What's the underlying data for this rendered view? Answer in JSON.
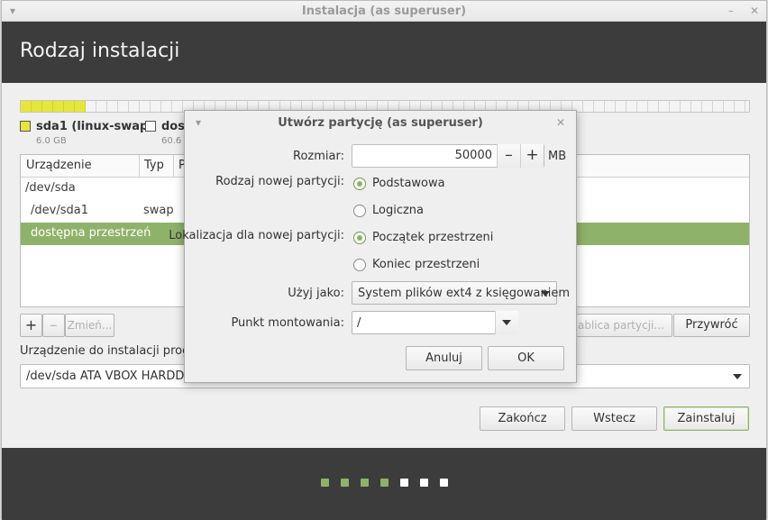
{
  "window": {
    "title": "Instalacja (as superuser)",
    "minimize_glyph": "–",
    "close_glyph": "✕",
    "menu_glyph": "▾"
  },
  "header": {
    "title": "Rodzaj instalacji"
  },
  "legend": [
    {
      "name": "sda1 (linux-swap)",
      "size": "6.0 GB",
      "color": "#e6e63a"
    },
    {
      "name": "dost",
      "size": "60.6 G",
      "color": "#ffffff"
    }
  ],
  "table": {
    "columns": [
      "Urządzenie",
      "Typ",
      "P"
    ],
    "rows": [
      {
        "device": "/dev/sda",
        "type": ""
      },
      {
        "device": "/dev/sda1",
        "type": "swap"
      },
      {
        "device": "dostępna przestrzeń",
        "type": "",
        "selected": true
      }
    ]
  },
  "table_buttons": {
    "add": "+",
    "remove": "–",
    "change": "Zmień...",
    "new_table": "ablica partycji...",
    "revert": "Przywróć"
  },
  "boot": {
    "label": "Urządzenie do instalacji program",
    "value": "/dev/sda ATA VBOX HARDDISK"
  },
  "actions": {
    "quit": "Zakończ",
    "back": "Wstecz",
    "install": "Zainstaluj"
  },
  "progress_dots": [
    true,
    true,
    true,
    true,
    false,
    false,
    false
  ],
  "colors": {
    "accent": "#8fb26a",
    "dark": "#3c3c3c"
  },
  "dialog": {
    "title": "Utwórz partycję (as superuser)",
    "size_label": "Rozmiar:",
    "size_value": "50000",
    "size_unit": "MB",
    "minus": "–",
    "plus": "+",
    "type_label": "Rodzaj nowej partycji:",
    "type_primary": "Podstawowa",
    "type_logical": "Logiczna",
    "location_label": "Lokalizacja dla nowej partycji:",
    "location_begin": "Początek przestrzeni",
    "location_end": "Koniec przestrzeni",
    "use_as_label": "Użyj jako:",
    "use_as_value": "System plików ext4 z księgowaniem",
    "mount_label": "Punkt montowania:",
    "mount_value": "/",
    "cancel": "Anuluj",
    "ok": "OK",
    "close_glyph": "✕",
    "menu_glyph": "▾"
  }
}
